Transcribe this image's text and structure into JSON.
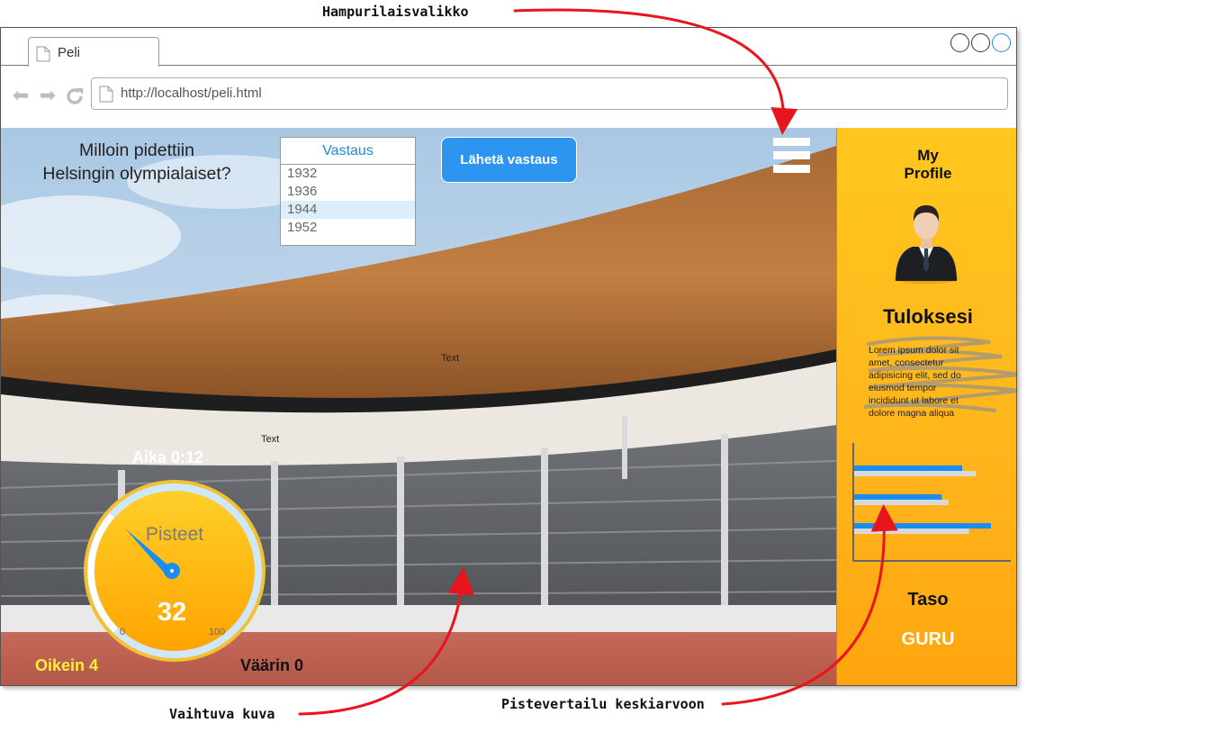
{
  "annotations": {
    "hamburger": "Hampurilaisvalikko",
    "image": "Vaihtuva kuva",
    "comparison": "Pistevertailu keskiarvoon"
  },
  "browser": {
    "tab_title": "Peli",
    "url": "http://localhost/peli.html"
  },
  "question": {
    "line1": "Milloin pidettiin",
    "line2": "Helsingin olympialaiset?"
  },
  "answers": {
    "header": "Vastaus",
    "options": [
      "1932",
      "1936",
      "1944",
      "1952"
    ],
    "selected_index": 2
  },
  "send_button": "Lähetä vastaus",
  "placeholder_text": [
    "Text",
    "Text"
  ],
  "timer": "Aika 0:12",
  "gauge": {
    "label": "Pisteet",
    "value": "32",
    "min": "0",
    "max": "100",
    "fraction": 0.32
  },
  "correct": "Oikein 4",
  "wrong": "Väärin 0",
  "sidebar": {
    "title_line1": "My",
    "title_line2": "Profile",
    "results_heading": "Tuloksesi",
    "lorem": [
      "Lorem ipsum dolor sit",
      "amet, consectetur",
      "adipisicing elit, sed do",
      "eiusmod tempor",
      "incididunt ut labore et",
      "dolore magna aliqua"
    ],
    "chart": {
      "series": [
        {
          "color": "#1a8df0",
          "values": [
            0.79,
            0.64,
            1.0
          ]
        },
        {
          "color": "#d9d9d9",
          "values": [
            0.89,
            0.69,
            0.84
          ]
        }
      ]
    },
    "level_label": "Taso",
    "level_value": "GURU"
  },
  "colors": {
    "accent_blue": "#2b95ef",
    "sidebar_orange": "#ffb11a",
    "arrow_red": "#e8141e"
  }
}
